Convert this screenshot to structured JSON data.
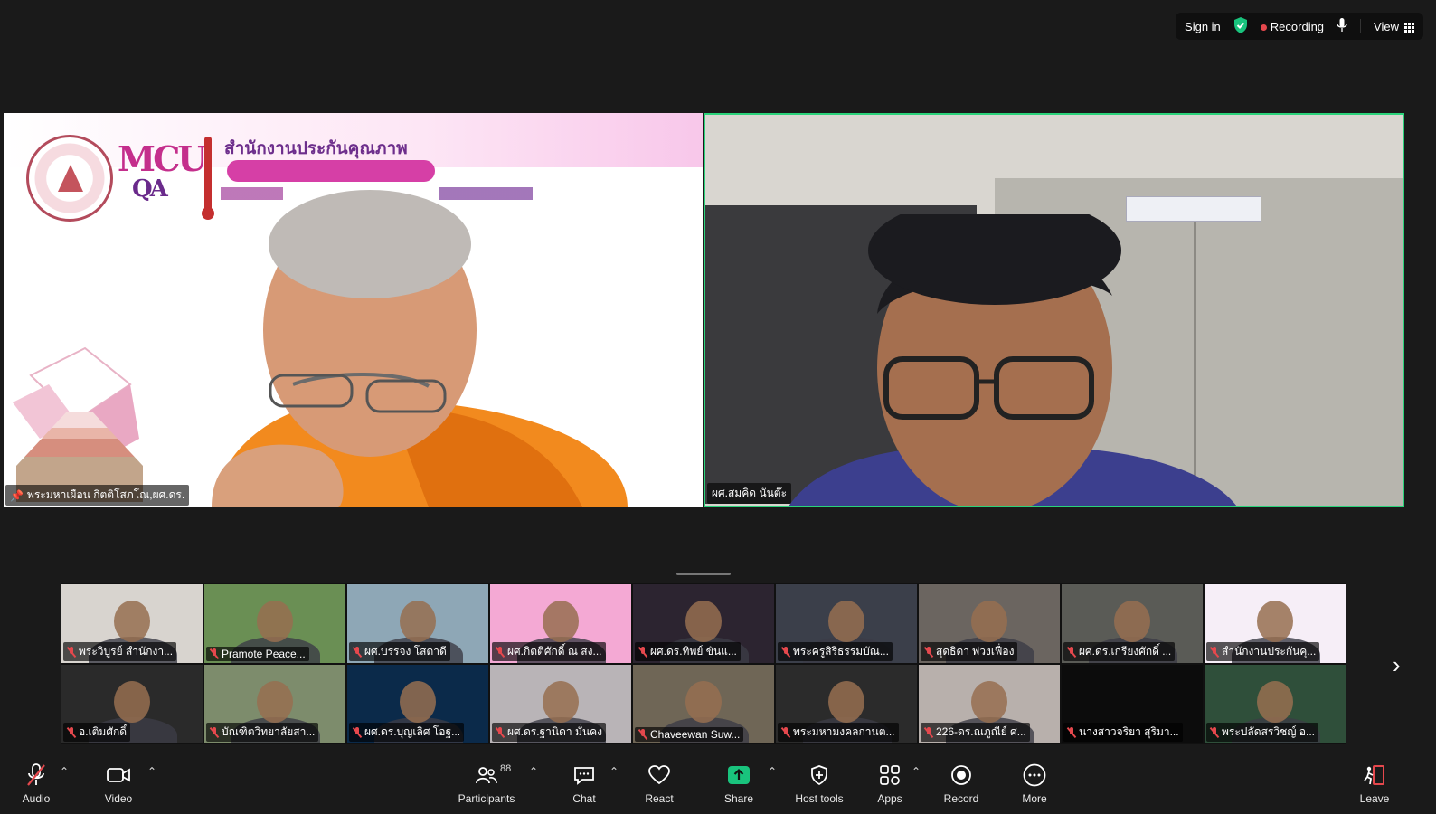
{
  "topbar": {
    "sign_in": "Sign in",
    "recording": "Recording",
    "view": "View"
  },
  "main_tiles": {
    "left_name": "พระมหาเผือน กิตติโสภโณ,ผศ.ดร.",
    "right_name": "ผศ.สมคิด นันต๊ะ",
    "left_banner": {
      "brand": "MCU",
      "brand_sub": "QA",
      "title": "สำนักงานประกันคุณภาพ"
    }
  },
  "gallery": {
    "participants": [
      {
        "name": "พระวิบูรย์ สำนักงา...",
        "bg": "#d8d4cf"
      },
      {
        "name": "Pramote  Peace...",
        "bg": "#6a8f54"
      },
      {
        "name": "ผศ.บรรจง โสดาดี",
        "bg": "#8ea7b6"
      },
      {
        "name": "ผศ.กิตติศักดิ์ ณ สง...",
        "bg": "#f4a9d4"
      },
      {
        "name": "ผศ.ดร.ทิพย์  ขันแ...",
        "bg": "#2c2430"
      },
      {
        "name": "พระครูสิริธรรมบัณ...",
        "bg": "#3b3f4a"
      },
      {
        "name": "สุดธิดา พ่วงเฟื่อง",
        "bg": "#6b6560"
      },
      {
        "name": "ผศ.ดร.เกรียงศักดิ์  ...",
        "bg": "#5a5b56"
      },
      {
        "name": "สำนักงานประกันคุ...",
        "bg": "#f6eef7"
      },
      {
        "name": "อ.เติมศักดิ์",
        "bg": "#2a2a2a"
      },
      {
        "name": "บัณฑิตวิทยาลัยสา...",
        "bg": "#7d8c6c"
      },
      {
        "name": "ผศ.ดร.บุญเลิศ โอฐ...",
        "bg": "#0b2a4a"
      },
      {
        "name": "ผศ.ดร.ฐานิดา มั่นคง",
        "bg": "#b9b4b7"
      },
      {
        "name": "Chaveewan Suw...",
        "bg": "#6f6656"
      },
      {
        "name": "พระมหามงคลกานต...",
        "bg": "#2b2b2b"
      },
      {
        "name": "226-ดร.ณภูณีย์ ศ...",
        "bg": "#b8b0ac"
      },
      {
        "name": "นางสาวจริยา สุริมา...",
        "bg": "#0c0c0c"
      },
      {
        "name": "พระปลัดสรวิชญ์  อ...",
        "bg": "#2f4f3a"
      }
    ]
  },
  "toolbar": {
    "audio": "Audio",
    "video": "Video",
    "participants": "Participants",
    "participants_count": "88",
    "chat": "Chat",
    "react": "React",
    "share": "Share",
    "host_tools": "Host tools",
    "apps": "Apps",
    "record": "Record",
    "more": "More",
    "leave": "Leave"
  },
  "colors": {
    "active_speaker_border": "#2ad37a",
    "share_green": "#19c37d",
    "recording_red": "#e5484d"
  }
}
